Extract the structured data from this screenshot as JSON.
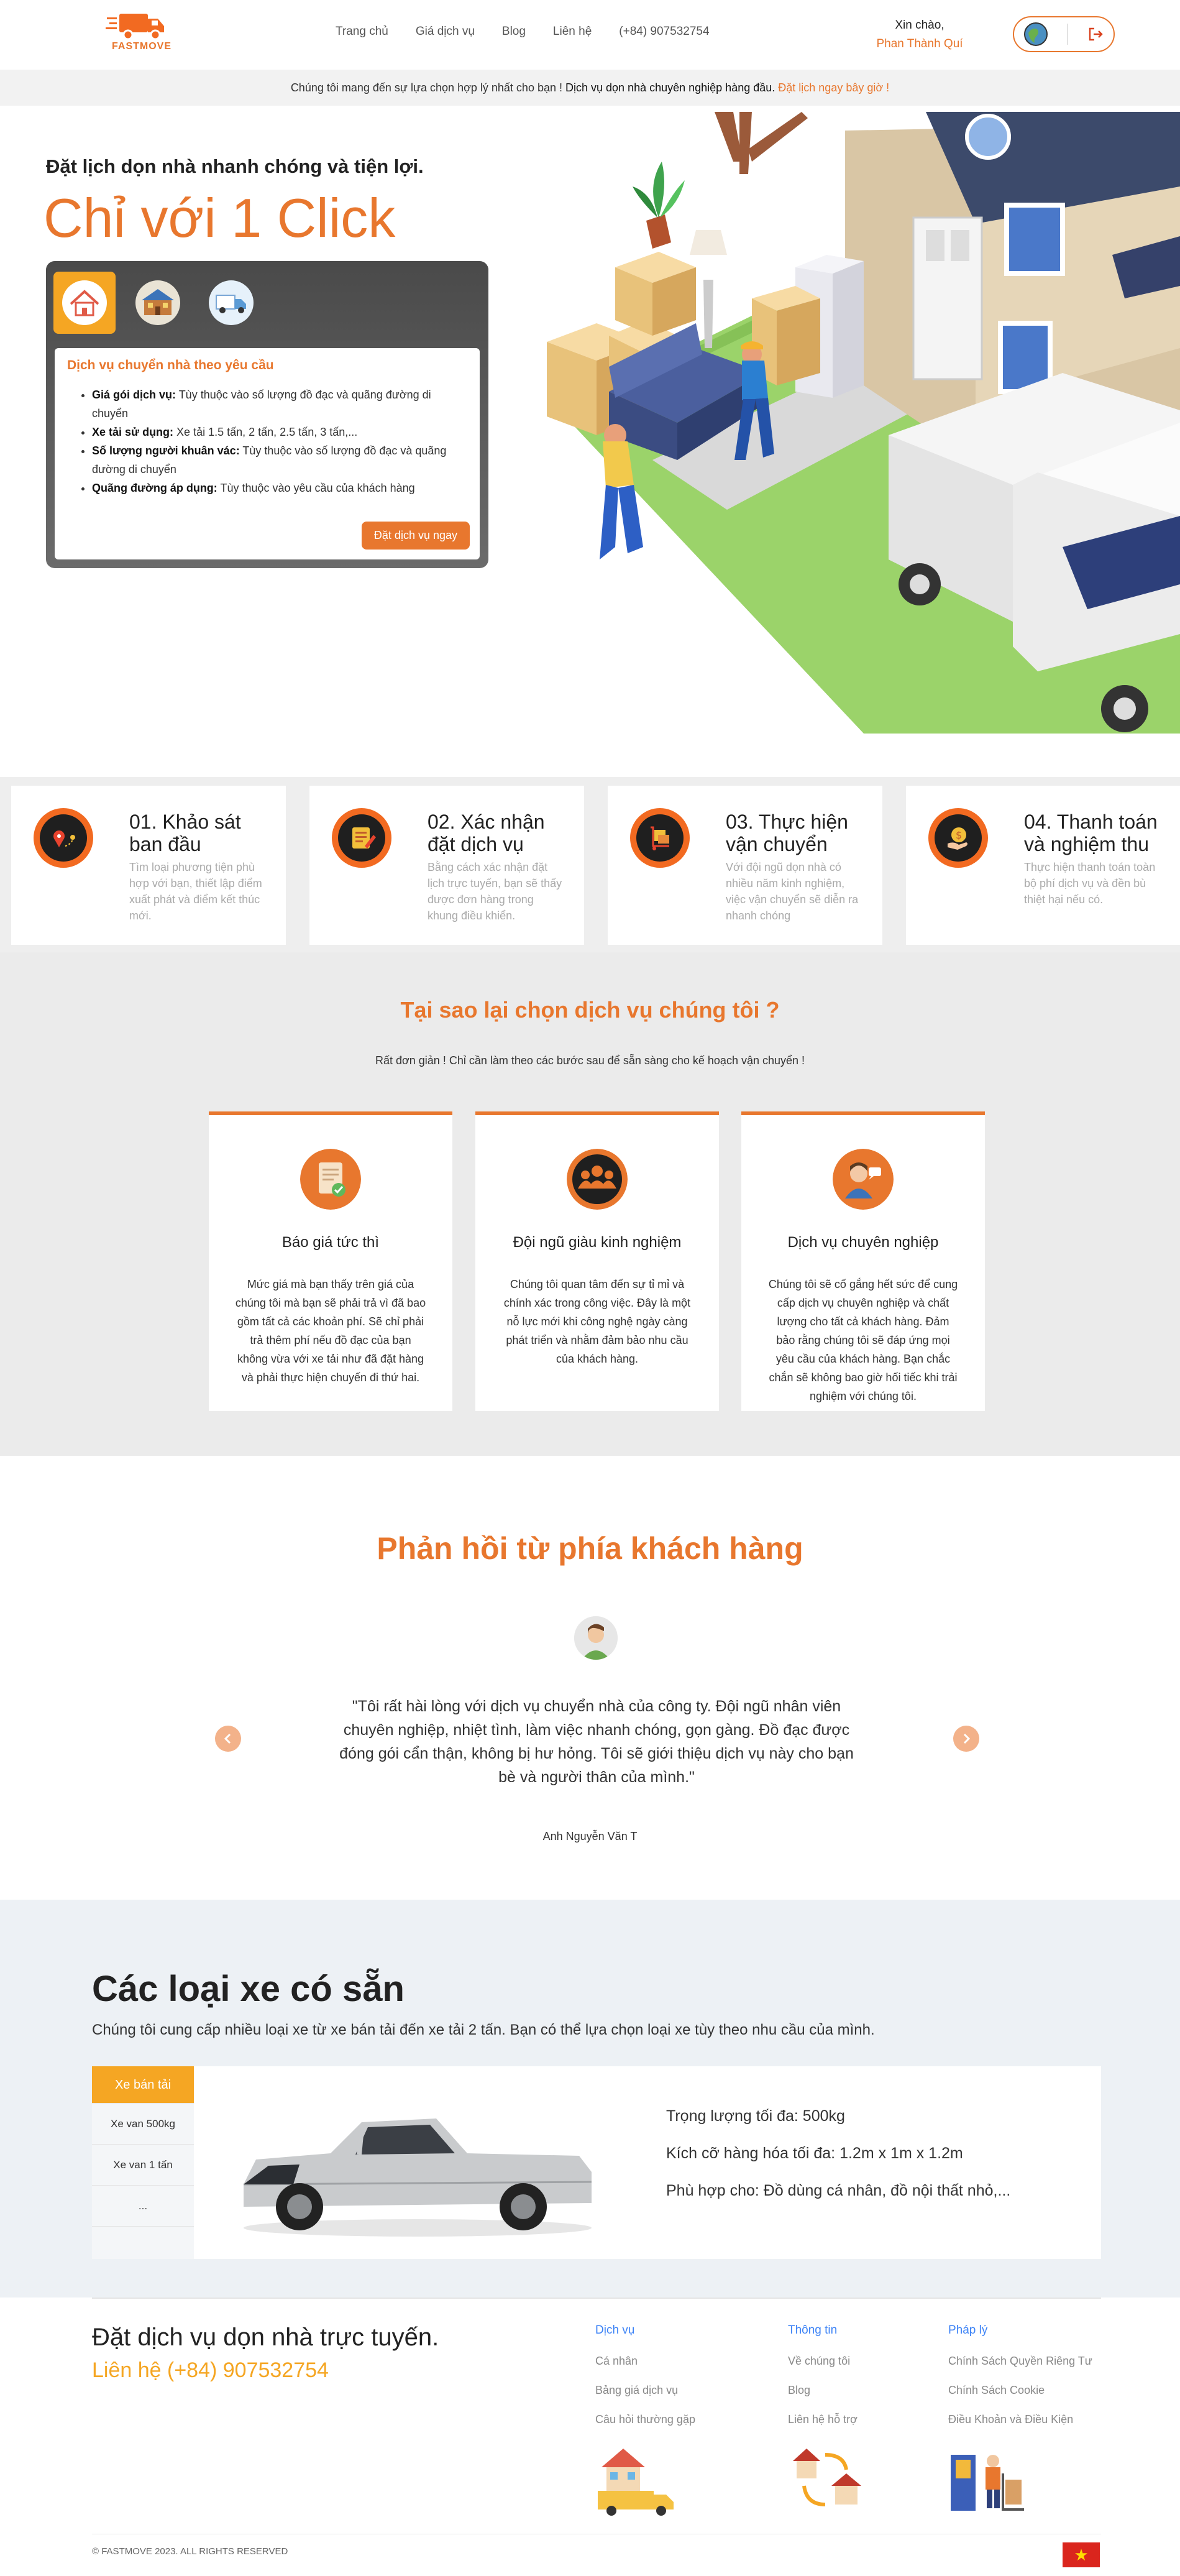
{
  "brand": {
    "name": "FASTMOVE",
    "accent": "#e8772e"
  },
  "nav": {
    "home": "Trang chủ",
    "pricing": "Giá dịch vụ",
    "blog": "Blog",
    "contact": "Liên hệ",
    "phone": "(+84) 907532754"
  },
  "user": {
    "greeting": "Xin chào,",
    "name": "Phan Thành Quí"
  },
  "announce": {
    "text": "Chúng tôi mang đến sự lựa chọn hợp lý nhất cho bạn ! ",
    "bold": "Dịch vụ dọn nhà chuyên nghiệp hàng đầu.",
    "cta": " Đặt lịch ngay bây giờ !"
  },
  "hero": {
    "subtitle": "Đặt lịch dọn nhà nhanh chóng và tiện lợi.",
    "title": "Chỉ với 1 Click",
    "card_title": "Dịch vụ chuyển nhà theo yêu cầu",
    "items": [
      {
        "label": "Giá gói dịch vụ:",
        "text": " Tùy thuộc vào số lượng đồ đạc và quãng đường di chuyển"
      },
      {
        "label": "Xe tải sử dụng:",
        "text": " Xe tải 1.5 tấn, 2 tấn, 2.5 tấn, 3 tấn,..."
      },
      {
        "label": "Số lượng người khuân vác:",
        "text": " Tùy thuộc vào số lượng đồ đạc và quãng đường di chuyển"
      },
      {
        "label": "Quãng đường áp dụng:",
        "text": " Tùy thuộc vào yêu cầu của khách hàng"
      }
    ],
    "button": "Đặt dịch vụ ngay"
  },
  "steps": [
    {
      "title": "01. Khảo sát ban đầu",
      "desc": "Tìm loại phương tiện phù hợp với bạn, thiết lập điểm xuất phát và điểm kết thúc mới."
    },
    {
      "title": "02. Xác nhận đặt dịch vụ",
      "desc": "Bằng cách xác nhận đặt lịch trực tuyến, bạn sẽ thấy được đơn hàng trong khung điều khiển."
    },
    {
      "title": "03. Thực hiện vận chuyển",
      "desc": "Với đội ngũ dọn nhà có nhiều năm kinh nghiệm, việc vận chuyển sẽ diễn ra nhanh chóng"
    },
    {
      "title": "04. Thanh toán và nghiệm thu",
      "desc": "Thực hiện thanh toán toàn bộ phí dịch vụ và đền bù thiệt hại nếu có."
    }
  ],
  "why": {
    "title": "Tại sao lại chọn dịch vụ chúng tôi ?",
    "subtitle": "Rất đơn giản ! Chỉ cần làm theo các bước sau để sẵn sàng cho kế hoạch vận chuyển !",
    "cards": [
      {
        "title": "Báo giá tức thì",
        "text": "Mức giá mà bạn thấy trên giá của chúng tôi mà bạn sẽ phải trả vì đã bao gồm tất cả các khoản phí. Sẽ chỉ phải trả thêm phí nếu đồ đạc của bạn không vừa với xe tải như đã đặt hàng và phải thực hiện chuyến đi thứ hai."
      },
      {
        "title": "Đội ngũ giàu kinh nghiệm",
        "text": "Chúng tôi quan tâm đến sự tỉ mỉ và chính xác trong công việc. Đây là một nỗ lực mới khi công nghệ ngày càng phát triển và nhằm đảm bảo nhu cầu của khách hàng."
      },
      {
        "title": "Dịch vụ chuyên nghiệp",
        "text": "Chúng tôi sẽ cố gắng hết sức để cung cấp dịch vụ chuyên nghiệp và chất lượng cho tất cả khách hàng. Đảm bảo rằng chúng tôi sẽ đáp ứng mọi yêu cầu của khách hàng. Bạn chắc chắn sẽ không bao giờ hối tiếc khi trải nghiệm với chúng tôi."
      }
    ]
  },
  "testimonial": {
    "title": "Phản hồi từ phía khách hàng",
    "quote": "\"Tôi rất hài lòng với dịch vụ chuyển nhà của công ty. Đội ngũ nhân viên chuyên nghiệp, nhiệt tình, làm việc nhanh chóng, gọn gàng. Đồ đạc được đóng gói cẩn thận, không bị hư hỏng. Tôi sẽ giới thiệu dịch vụ này cho bạn bè và người thân của mình.\"",
    "author": "Anh Nguyễn Văn T"
  },
  "vehicles": {
    "title": "Các loại xe có sẵn",
    "subtitle": "Chúng tôi cung cấp nhiều loại xe từ xe bán tải đến xe tải 2 tấn. Bạn có thể lựa chọn loại xe tùy theo nhu cầu của mình.",
    "tabs": [
      "Xe bán tải",
      "Xe van 500kg",
      "Xe van 1 tấn",
      "..."
    ],
    "info": [
      "Trọng lượng tối đa: 500kg",
      "Kích cỡ hàng hóa tối đa: 1.2m x 1m x 1.2m",
      "Phù hợp cho: Đồ dùng cá nhân, đồ nội thất nhỏ,..."
    ]
  },
  "footer": {
    "heading": "Đặt dịch vụ dọn nhà trực tuyến.",
    "contact": "Liên hệ (+84) 907532754",
    "col1": {
      "title": "Dịch vụ",
      "items": [
        "Cá nhân",
        "Bảng giá dịch vụ",
        "Câu hỏi thường gặp"
      ]
    },
    "col2": {
      "title": "Thông tin",
      "items": [
        "Về chúng tôi",
        "Blog",
        "Liên hệ hỗ trợ"
      ]
    },
    "col3": {
      "title": "Pháp lý",
      "items": [
        "Chính Sách Quyền Riêng Tư",
        "Chính Sách Cookie",
        "Điều Khoản và Điều Kiện"
      ]
    },
    "copyright": "© FASTMOVE 2023. ALL RIGHTS RESERVED"
  }
}
